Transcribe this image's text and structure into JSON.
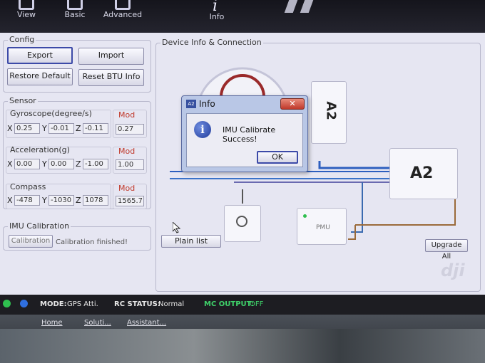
{
  "toolbar": {
    "items": [
      {
        "label": "View",
        "icon": "view-icon"
      },
      {
        "label": "Basic",
        "icon": "basic-icon"
      },
      {
        "label": "Advanced",
        "icon": "advanced-icon"
      },
      {
        "label": "Info",
        "icon": "info-icon"
      }
    ]
  },
  "config": {
    "legend": "Config",
    "export_label": "Export",
    "import_label": "Import",
    "restore_label": "Restore Default",
    "reset_btu_label": "Reset BTU Info"
  },
  "sensor": {
    "legend": "Sensor",
    "mod_label": "Mod",
    "gyroscope": {
      "label": "Gyroscope(degree/s)",
      "x": "0.25",
      "y": "-0.01",
      "z": "-0.11",
      "mod": "0.27"
    },
    "acceleration": {
      "label": "Acceleration(g)",
      "x": "0.00",
      "y": "0.00",
      "z": "-1.00",
      "mod": "1.00"
    },
    "compass": {
      "label": "Compass",
      "x": "-478",
      "y": "-1030",
      "z": "1078",
      "mod": "1565.7"
    },
    "axis_x": "X",
    "axis_y": "Y",
    "axis_z": "Z"
  },
  "imu": {
    "legend": "IMU Calibration",
    "button_label": "Calibration",
    "status": "Calibration finished!"
  },
  "device": {
    "legend": "Device Info & Connection",
    "a2_label": "A2",
    "a2_side_label": "A2",
    "pmu_label": "PMU",
    "plain_list_label": "Plain list",
    "upgrade_all_label": "Upgrade All",
    "watermark": "dji"
  },
  "dialog": {
    "title": "Info",
    "app_icon_text": "A2",
    "close_symbol": "✕",
    "message": "IMU Calibrate Success!",
    "ok_label": "OK"
  },
  "statusbar": {
    "mode_label": "MODE:",
    "mode_value": "GPS Atti.",
    "rc_label": "RC STATUS:",
    "rc_value": "Normal",
    "mc_label": "MC OUTPUT:",
    "mc_value": "OFF",
    "led_colors": [
      "#2fbf4f",
      "#2f6fdf"
    ]
  },
  "bottom": {
    "links": [
      "Home",
      "Soluti...",
      "Assistant..."
    ]
  }
}
